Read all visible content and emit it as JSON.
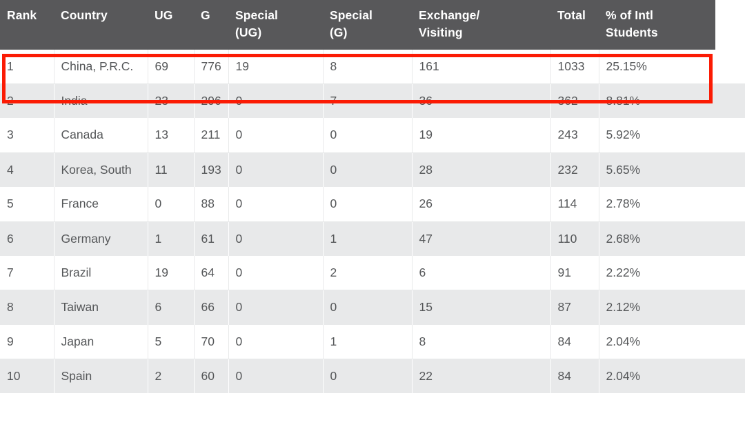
{
  "table": {
    "columns": [
      {
        "key": "rank",
        "label": "Rank"
      },
      {
        "key": "country",
        "label": "Country"
      },
      {
        "key": "ug",
        "label": "UG"
      },
      {
        "key": "g",
        "label": "G"
      },
      {
        "key": "s_ug",
        "label": "Special (UG)"
      },
      {
        "key": "s_g",
        "label": "Special (G)"
      },
      {
        "key": "exchange",
        "label": "Exchange/ Visiting"
      },
      {
        "key": "total",
        "label": "Total"
      },
      {
        "key": "pct",
        "label": "% of Intl Students"
      }
    ],
    "column_labels": {
      "rank": "Rank",
      "country": "Country",
      "ug": "UG",
      "g": "G",
      "s_ug_line1": "Special",
      "s_ug_line2": "(UG)",
      "s_g_line1": "Special",
      "s_g_line2": "(G)",
      "exchange_line1": "Exchange/",
      "exchange_line2": "Visiting",
      "total": "Total",
      "pct_line1": "% of Intl",
      "pct_line2": "Students"
    },
    "rows": [
      {
        "rank": "1",
        "country": "China, P.R.C.",
        "ug": "69",
        "g": "776",
        "s_ug": "19",
        "s_g": "8",
        "exchange": "161",
        "total": "1033",
        "pct": "25.15%"
      },
      {
        "rank": "2",
        "country": "India",
        "ug": "23",
        "g": "296",
        "s_ug": "0",
        "s_g": "7",
        "exchange": "36",
        "total": "362",
        "pct": "8.81%"
      },
      {
        "rank": "3",
        "country": "Canada",
        "ug": "13",
        "g": "211",
        "s_ug": "0",
        "s_g": "0",
        "exchange": "19",
        "total": "243",
        "pct": "5.92%"
      },
      {
        "rank": "4",
        "country": "Korea, South",
        "ug": "11",
        "g": "193",
        "s_ug": "0",
        "s_g": "0",
        "exchange": "28",
        "total": "232",
        "pct": "5.65%"
      },
      {
        "rank": "5",
        "country": "France",
        "ug": "0",
        "g": "88",
        "s_ug": "0",
        "s_g": "0",
        "exchange": "26",
        "total": "114",
        "pct": "2.78%"
      },
      {
        "rank": "6",
        "country": "Germany",
        "ug": "1",
        "g": "61",
        "s_ug": "0",
        "s_g": "1",
        "exchange": "47",
        "total": "110",
        "pct": "2.68%"
      },
      {
        "rank": "7",
        "country": "Brazil",
        "ug": "19",
        "g": "64",
        "s_ug": "0",
        "s_g": "2",
        "exchange": "6",
        "total": "91",
        "pct": "2.22%"
      },
      {
        "rank": "8",
        "country": "Taiwan",
        "ug": "6",
        "g": "66",
        "s_ug": "0",
        "s_g": "0",
        "exchange": "15",
        "total": "87",
        "pct": "2.12%"
      },
      {
        "rank": "9",
        "country": "Japan",
        "ug": "5",
        "g": "70",
        "s_ug": "0",
        "s_g": "1",
        "exchange": "8",
        "total": "84",
        "pct": "2.04%"
      },
      {
        "rank": "10",
        "country": "Spain",
        "ug": "2",
        "g": "60",
        "s_ug": "0",
        "s_g": "0",
        "exchange": "22",
        "total": "84",
        "pct": "2.04%"
      }
    ],
    "highlighted_row_rank": "1"
  },
  "colors": {
    "header_background": "#58585a",
    "header_text": "#ffffff",
    "row_text": "#555759",
    "row_even_background": "#e8e9ea",
    "row_odd_background": "#ffffff",
    "highlight_border": "#fb1b04"
  }
}
